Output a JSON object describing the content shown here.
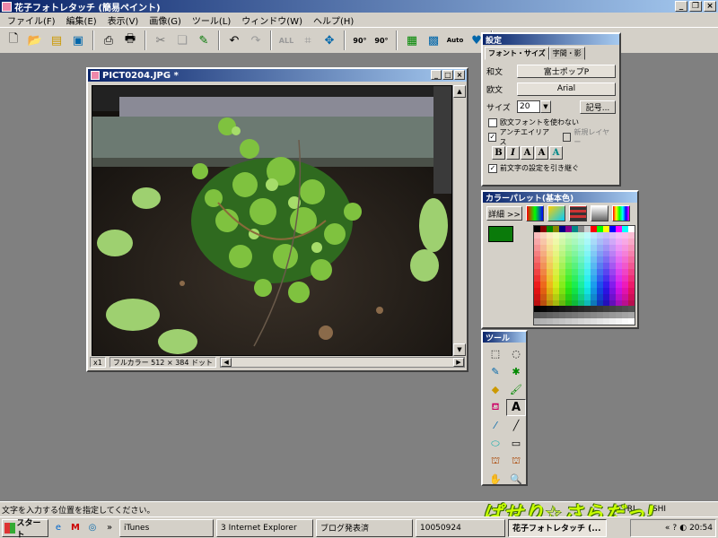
{
  "app": {
    "title": "花子フォトレタッチ (簡易ペイント)"
  },
  "menu": [
    "ファイル(F)",
    "編集(E)",
    "表示(V)",
    "画像(G)",
    "ツール(L)",
    "ウィンドウ(W)",
    "ヘルプ(H)"
  ],
  "toolbar": {
    "icons": [
      "new-file-icon",
      "open-folder-icon",
      "save-icon",
      "scan-icon",
      "print-preview-icon",
      "print-icon",
      "cut-icon",
      "copy-icon",
      "paste-icon",
      "undo-icon",
      "redo-icon",
      "select-all-icon",
      "crop-icon",
      "resize-icon",
      "rotate-left-icon",
      "rotate-right-icon",
      "adjust-icon",
      "effect-icon",
      "auto-icon",
      "heart-icon",
      "help-icon"
    ],
    "rot_left": "90°",
    "rot_right": "90°",
    "all_label": "ALL",
    "auto_label": "Auto",
    "help_label": "?"
  },
  "image_window": {
    "title": "PICT0204.JPG *",
    "zoom": "x1",
    "color_mode": "フルカラー 512 × 384 ドット"
  },
  "settings_panel": {
    "title": "設定",
    "tabs": [
      "フォント・サイズ",
      "字間・影"
    ],
    "japanese_label": "和文",
    "japanese_font": "富士ポップP",
    "western_label": "欧文",
    "western_font": "Arial",
    "size_label": "サイズ",
    "size_value": "20",
    "symbol_button": "記号...",
    "chk_no_western": "欧文フォントを使わない",
    "chk_antialias": "アンチエイリアス",
    "chk_new_layer": "新規レイヤー",
    "chk_inherit": "前文字の設定を引き継ぐ",
    "style_buttons": [
      "B",
      "I",
      "A",
      "A",
      "A"
    ]
  },
  "palette_panel": {
    "title": "カラーパレット(基本色)",
    "detail_button": "詳細 >>",
    "fg_color": "#0a7a0a",
    "bg_color": "#ffffff"
  },
  "tools_panel": {
    "title": "ツール",
    "tools": [
      "rect-select-icon",
      "lasso-icon",
      "pen-icon",
      "spray-icon",
      "eraser-icon",
      "brush-icon",
      "fill-icon",
      "text-icon",
      "dropper-icon",
      "line-icon",
      "ellipse-icon",
      "rectangle-icon",
      "stamp-icon",
      "clone-icon",
      "hand-icon",
      "zoom-icon"
    ],
    "text_tool_label": "A"
  },
  "status": {
    "message": "文字を入力する位置を指定してください。",
    "ctrl": "CTRL",
    "shift": "SHI"
  },
  "watermark": "ぱせり☆さらだっ!",
  "taskbar": {
    "start": "スタート",
    "tasks": [
      "iTunes",
      "3 Internet Explorer",
      "ブログ発表済",
      "10050924",
      "花子フォトレタッチ (..."
    ],
    "clock": "20:54"
  }
}
